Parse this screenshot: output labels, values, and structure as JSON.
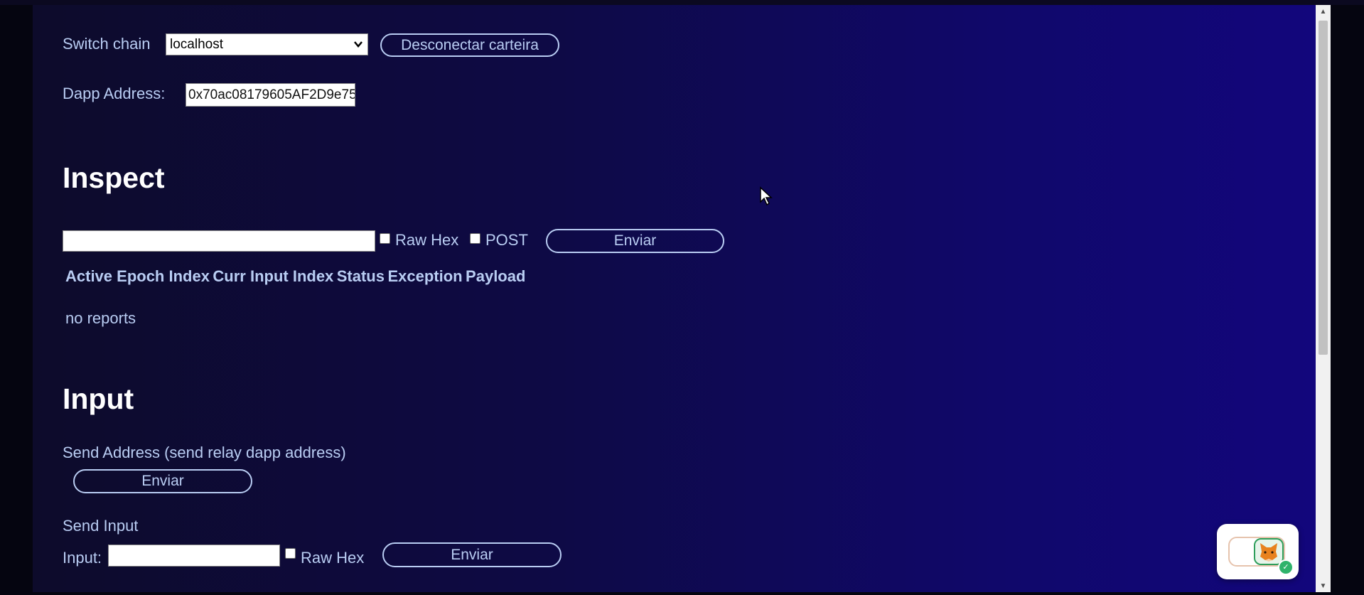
{
  "header": {
    "switch_chain_label": "Switch chain",
    "chain_selected": "localhost",
    "disconnect_label": "Desconectar carteira",
    "dapp_address_label": "Dapp Address:",
    "dapp_address_value": "0x70ac08179605AF2D9e75"
  },
  "inspect": {
    "title": "Inspect",
    "raw_hex_label": "Raw Hex",
    "post_label": "POST",
    "send_label": "Enviar",
    "table_headers": [
      "Active Epoch Index",
      "Curr Input Index",
      "Status",
      "Exception",
      "Payload"
    ],
    "empty_text": "no reports"
  },
  "input_section": {
    "title": "Input",
    "send_address_label": "Send Address (send relay dapp address)",
    "send_address_button": "Enviar",
    "send_input_label": "Send Input",
    "input_label": "Input:",
    "raw_hex_label": "Raw Hex",
    "send_input_button": "Enviar"
  },
  "icons": {
    "chain_dropdown": "chevron-down-icon",
    "cursor": "mouse-pointer-icon",
    "wallet_widget": "metamask-fox-icon",
    "wallet_status": "checkmark-icon"
  },
  "colors": {
    "text": "#b9cdf3",
    "heading": "#ffffff",
    "background_start": "#0d0b2b",
    "background_end": "#12067c"
  }
}
